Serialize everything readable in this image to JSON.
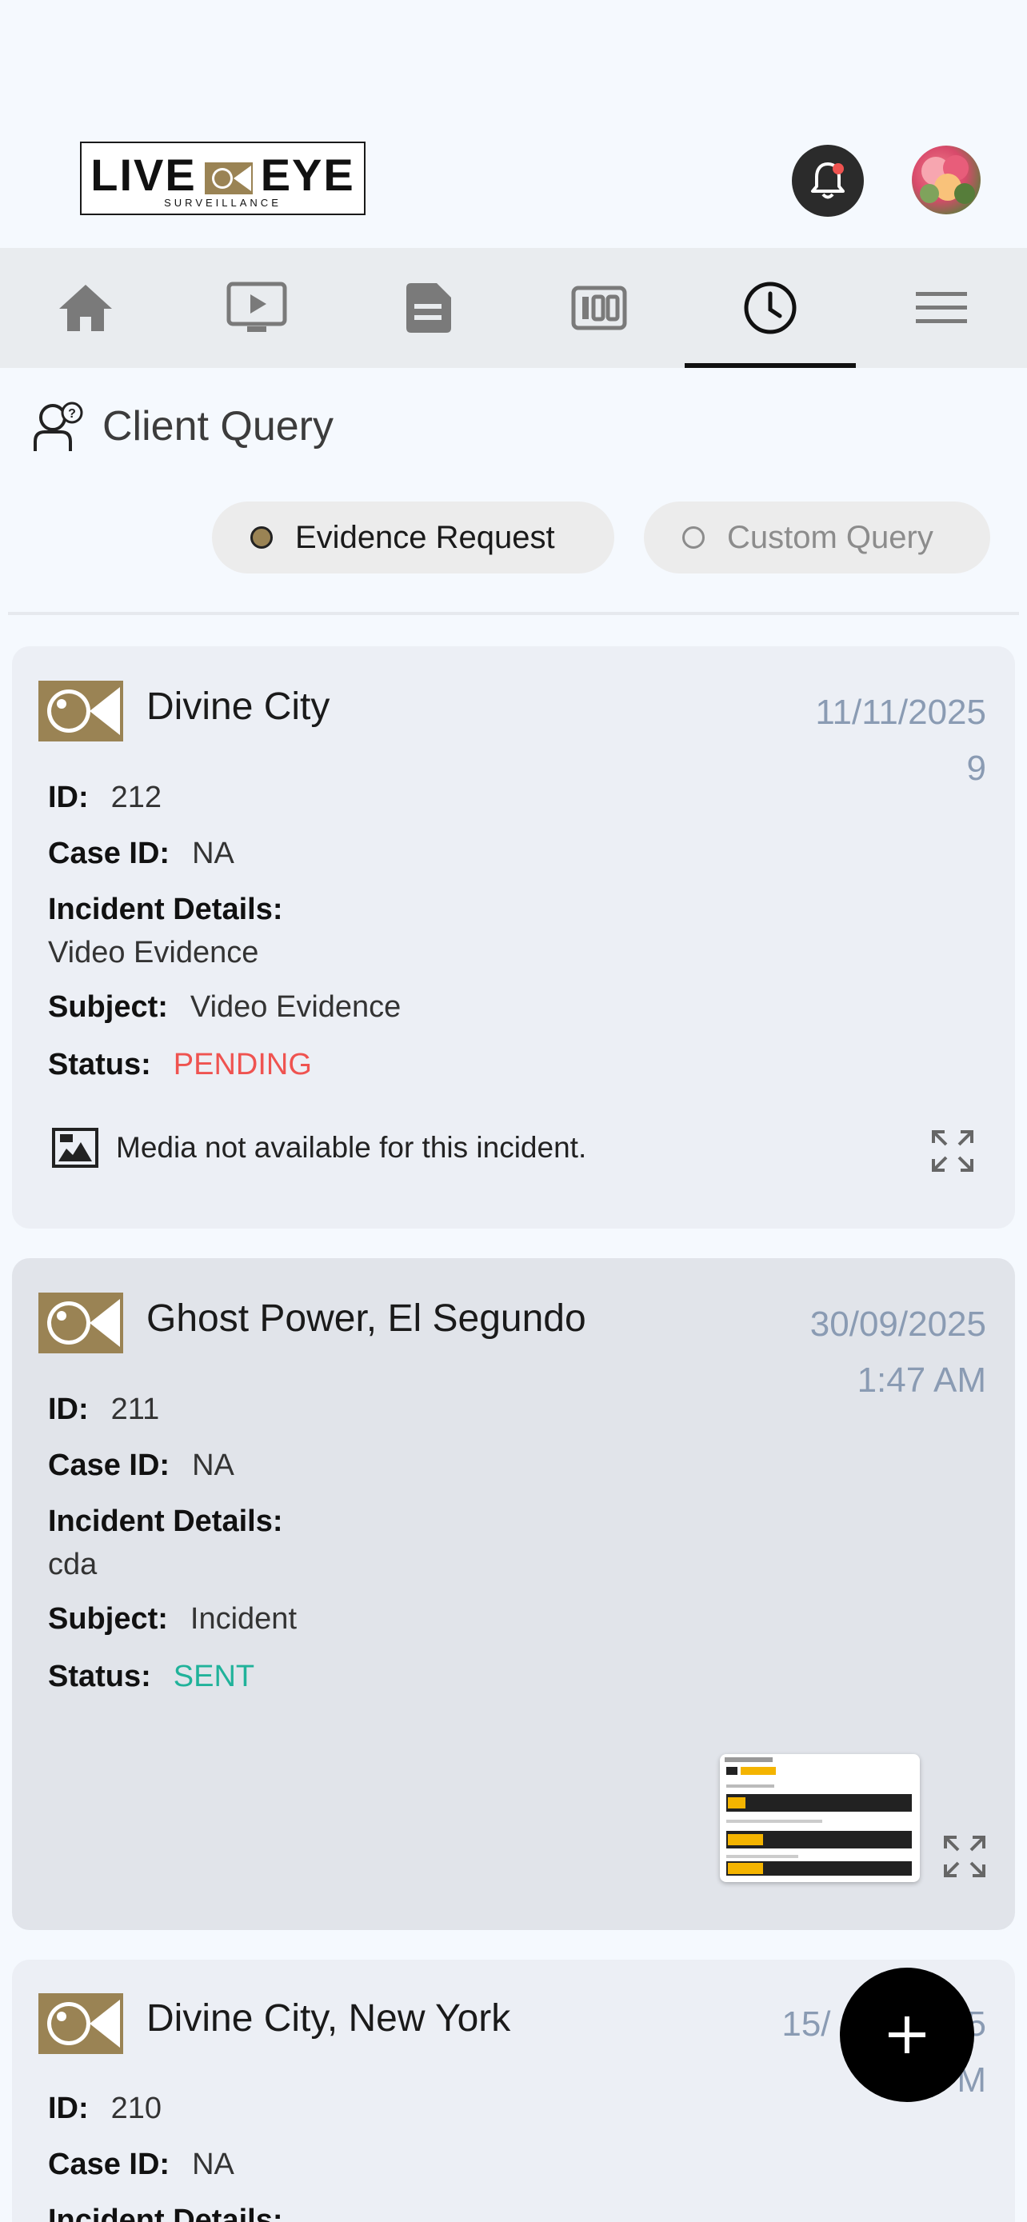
{
  "header": {
    "logo_main_left": "LIVE",
    "logo_main_right": "EYE",
    "logo_sub": "SURVEILLANCE",
    "brand_color": "#9a8354"
  },
  "nav": {
    "items": [
      {
        "icon": "home-icon"
      },
      {
        "icon": "video-play-icon"
      },
      {
        "icon": "document-icon"
      },
      {
        "icon": "counter-icon"
      },
      {
        "icon": "clock-icon",
        "active": true
      },
      {
        "icon": "menu-icon"
      }
    ]
  },
  "page": {
    "title": "Client Query",
    "tabs": {
      "evidence_label": "Evidence Request",
      "custom_label": "Custom Query",
      "selected": "Evidence Request"
    }
  },
  "labels": {
    "id": "ID:",
    "case_id": "Case ID:",
    "incident_details": "Incident Details:",
    "subject": "Subject:",
    "status": "Status:"
  },
  "cards": [
    {
      "name": "Divine City",
      "date_line1": "11/11/2025",
      "date_line2": "9",
      "id": "212",
      "case_id": "NA",
      "incident_details": "Video Evidence",
      "subject": "Video Evidence",
      "status": "PENDING",
      "media_text": "Media not available for this incident."
    },
    {
      "name": "Ghost Power, El Segundo",
      "date_line1": "30/09/2025",
      "date_line2": "1:47 AM",
      "id": "211",
      "case_id": "NA",
      "incident_details": "cda",
      "subject": "Incident",
      "status": "SENT"
    },
    {
      "name": "Divine City, New York",
      "date_line1": "15/",
      "date_line1_end": "5",
      "date_line2": "M",
      "id": "210",
      "case_id": "NA"
    }
  ],
  "colors": {
    "pending": "#ef5350",
    "sent": "#20b29a",
    "date": "#8a9bb3"
  }
}
